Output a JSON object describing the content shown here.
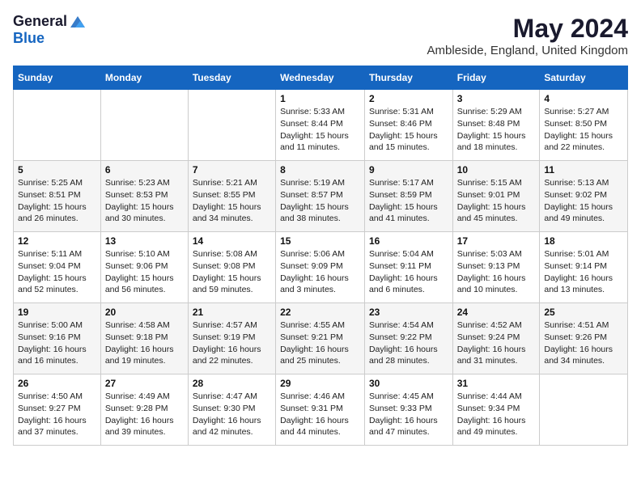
{
  "header": {
    "logo_general": "General",
    "logo_blue": "Blue",
    "title": "May 2024",
    "subtitle": "Ambleside, England, United Kingdom"
  },
  "days_of_week": [
    "Sunday",
    "Monday",
    "Tuesday",
    "Wednesday",
    "Thursday",
    "Friday",
    "Saturday"
  ],
  "weeks": [
    [
      {
        "day": "",
        "info": ""
      },
      {
        "day": "",
        "info": ""
      },
      {
        "day": "",
        "info": ""
      },
      {
        "day": "1",
        "info": "Sunrise: 5:33 AM\nSunset: 8:44 PM\nDaylight: 15 hours\nand 11 minutes."
      },
      {
        "day": "2",
        "info": "Sunrise: 5:31 AM\nSunset: 8:46 PM\nDaylight: 15 hours\nand 15 minutes."
      },
      {
        "day": "3",
        "info": "Sunrise: 5:29 AM\nSunset: 8:48 PM\nDaylight: 15 hours\nand 18 minutes."
      },
      {
        "day": "4",
        "info": "Sunrise: 5:27 AM\nSunset: 8:50 PM\nDaylight: 15 hours\nand 22 minutes."
      }
    ],
    [
      {
        "day": "5",
        "info": "Sunrise: 5:25 AM\nSunset: 8:51 PM\nDaylight: 15 hours\nand 26 minutes."
      },
      {
        "day": "6",
        "info": "Sunrise: 5:23 AM\nSunset: 8:53 PM\nDaylight: 15 hours\nand 30 minutes."
      },
      {
        "day": "7",
        "info": "Sunrise: 5:21 AM\nSunset: 8:55 PM\nDaylight: 15 hours\nand 34 minutes."
      },
      {
        "day": "8",
        "info": "Sunrise: 5:19 AM\nSunset: 8:57 PM\nDaylight: 15 hours\nand 38 minutes."
      },
      {
        "day": "9",
        "info": "Sunrise: 5:17 AM\nSunset: 8:59 PM\nDaylight: 15 hours\nand 41 minutes."
      },
      {
        "day": "10",
        "info": "Sunrise: 5:15 AM\nSunset: 9:01 PM\nDaylight: 15 hours\nand 45 minutes."
      },
      {
        "day": "11",
        "info": "Sunrise: 5:13 AM\nSunset: 9:02 PM\nDaylight: 15 hours\nand 49 minutes."
      }
    ],
    [
      {
        "day": "12",
        "info": "Sunrise: 5:11 AM\nSunset: 9:04 PM\nDaylight: 15 hours\nand 52 minutes."
      },
      {
        "day": "13",
        "info": "Sunrise: 5:10 AM\nSunset: 9:06 PM\nDaylight: 15 hours\nand 56 minutes."
      },
      {
        "day": "14",
        "info": "Sunrise: 5:08 AM\nSunset: 9:08 PM\nDaylight: 15 hours\nand 59 minutes."
      },
      {
        "day": "15",
        "info": "Sunrise: 5:06 AM\nSunset: 9:09 PM\nDaylight: 16 hours\nand 3 minutes."
      },
      {
        "day": "16",
        "info": "Sunrise: 5:04 AM\nSunset: 9:11 PM\nDaylight: 16 hours\nand 6 minutes."
      },
      {
        "day": "17",
        "info": "Sunrise: 5:03 AM\nSunset: 9:13 PM\nDaylight: 16 hours\nand 10 minutes."
      },
      {
        "day": "18",
        "info": "Sunrise: 5:01 AM\nSunset: 9:14 PM\nDaylight: 16 hours\nand 13 minutes."
      }
    ],
    [
      {
        "day": "19",
        "info": "Sunrise: 5:00 AM\nSunset: 9:16 PM\nDaylight: 16 hours\nand 16 minutes."
      },
      {
        "day": "20",
        "info": "Sunrise: 4:58 AM\nSunset: 9:18 PM\nDaylight: 16 hours\nand 19 minutes."
      },
      {
        "day": "21",
        "info": "Sunrise: 4:57 AM\nSunset: 9:19 PM\nDaylight: 16 hours\nand 22 minutes."
      },
      {
        "day": "22",
        "info": "Sunrise: 4:55 AM\nSunset: 9:21 PM\nDaylight: 16 hours\nand 25 minutes."
      },
      {
        "day": "23",
        "info": "Sunrise: 4:54 AM\nSunset: 9:22 PM\nDaylight: 16 hours\nand 28 minutes."
      },
      {
        "day": "24",
        "info": "Sunrise: 4:52 AM\nSunset: 9:24 PM\nDaylight: 16 hours\nand 31 minutes."
      },
      {
        "day": "25",
        "info": "Sunrise: 4:51 AM\nSunset: 9:26 PM\nDaylight: 16 hours\nand 34 minutes."
      }
    ],
    [
      {
        "day": "26",
        "info": "Sunrise: 4:50 AM\nSunset: 9:27 PM\nDaylight: 16 hours\nand 37 minutes."
      },
      {
        "day": "27",
        "info": "Sunrise: 4:49 AM\nSunset: 9:28 PM\nDaylight: 16 hours\nand 39 minutes."
      },
      {
        "day": "28",
        "info": "Sunrise: 4:47 AM\nSunset: 9:30 PM\nDaylight: 16 hours\nand 42 minutes."
      },
      {
        "day": "29",
        "info": "Sunrise: 4:46 AM\nSunset: 9:31 PM\nDaylight: 16 hours\nand 44 minutes."
      },
      {
        "day": "30",
        "info": "Sunrise: 4:45 AM\nSunset: 9:33 PM\nDaylight: 16 hours\nand 47 minutes."
      },
      {
        "day": "31",
        "info": "Sunrise: 4:44 AM\nSunset: 9:34 PM\nDaylight: 16 hours\nand 49 minutes."
      },
      {
        "day": "",
        "info": ""
      }
    ]
  ]
}
